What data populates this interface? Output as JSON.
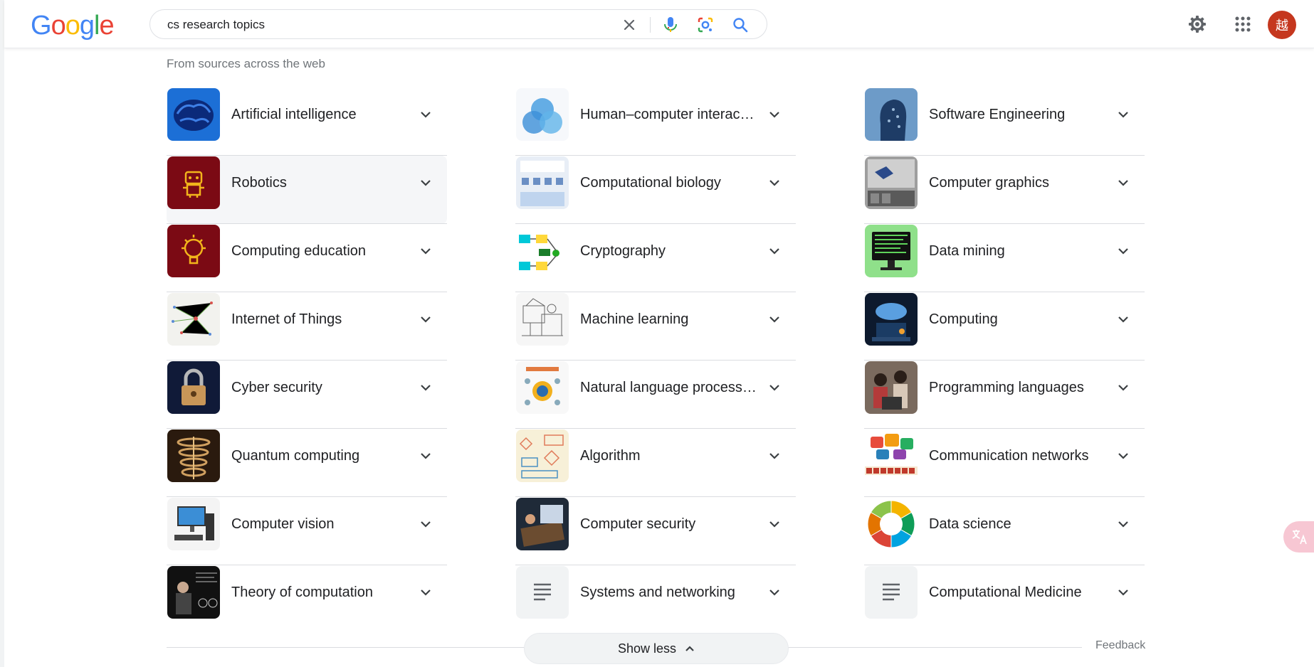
{
  "header": {
    "logo_letters": [
      {
        "ch": "G",
        "color": "#4285F4"
      },
      {
        "ch": "o",
        "color": "#EA4335"
      },
      {
        "ch": "o",
        "color": "#FBBC05"
      },
      {
        "ch": "g",
        "color": "#4285F4"
      },
      {
        "ch": "l",
        "color": "#34A853"
      },
      {
        "ch": "e",
        "color": "#EA4335"
      }
    ],
    "search_query": "cs research topics",
    "avatar_initial": "越"
  },
  "section": {
    "subtitle": "From sources across the web"
  },
  "columns": [
    [
      {
        "label": "Artificial intelligence",
        "thumb": "brain"
      },
      {
        "label": "Robotics",
        "thumb": "robot"
      },
      {
        "label": "Computing education",
        "thumb": "bulb"
      },
      {
        "label": "Internet of Things",
        "thumb": "network-map"
      },
      {
        "label": "Cyber security",
        "thumb": "padlock"
      },
      {
        "label": "Quantum computing",
        "thumb": "quantum"
      },
      {
        "label": "Computer vision",
        "thumb": "desktop-pc"
      },
      {
        "label": "Theory of computation",
        "thumb": "lecture"
      }
    ],
    [
      {
        "label": "Human–computer interac…",
        "thumb": "venn"
      },
      {
        "label": "Computational biology",
        "thumb": "bio-chart"
      },
      {
        "label": "Cryptography",
        "thumb": "crypto-diagram"
      },
      {
        "label": "Machine learning",
        "thumb": "sketch"
      },
      {
        "label": "Natural language process…",
        "thumb": "nlp-wheel"
      },
      {
        "label": "Algorithm",
        "thumb": "flowchart"
      },
      {
        "label": "Computer security",
        "thumb": "laptop-hands"
      },
      {
        "label": "Systems and networking",
        "thumb": "text-lines"
      }
    ],
    [
      {
        "label": "Software Engineering",
        "thumb": "digital-head"
      },
      {
        "label": "Computer graphics",
        "thumb": "graphics-ui"
      },
      {
        "label": "Data mining",
        "thumb": "monitor-code"
      },
      {
        "label": "Computing",
        "thumb": "cloud-laptop"
      },
      {
        "label": "Programming languages",
        "thumb": "people-laptop"
      },
      {
        "label": "Communication networks",
        "thumb": "communication"
      },
      {
        "label": "Data science",
        "thumb": "data-wheel"
      },
      {
        "label": "Computational Medicine",
        "thumb": "text-lines"
      }
    ]
  ],
  "footer": {
    "show_less_label": "Show less",
    "feedback_label": "Feedback"
  }
}
